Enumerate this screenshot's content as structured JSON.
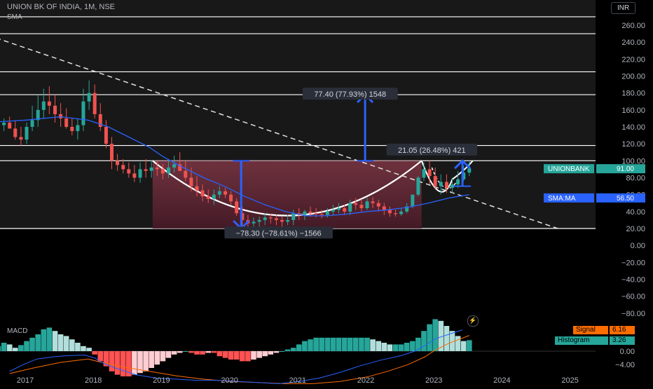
{
  "header": {
    "symbol_line": "UNION BK OF INDIA, 1M, NSE",
    "indicator_label": "SMA",
    "currency": "INR"
  },
  "colors": {
    "background": "#000000",
    "up_candle": "#26a69a",
    "down_candle": "#ef5350",
    "sma": "#2962ff",
    "macd_line": "#2962ff",
    "signal_line": "#ff6d00",
    "cup_fill": "#7a2a3c",
    "arrow": "#2962ff",
    "label_bg": "#2a2e39"
  },
  "chart_data": [
    {
      "type": "line",
      "panel": "price",
      "y_ticks": [
        "260.00",
        "240.00",
        "220.00",
        "200.00",
        "180.00",
        "160.00",
        "140.00",
        "120.00",
        "100.00",
        "80.00",
        "60.00",
        "40.00",
        "20.00",
        "0.00",
        "−20.00",
        "−40.00",
        "−60.00",
        "−80.00"
      ],
      "x_ticks": [
        "2017",
        "2018",
        "2019",
        "2020",
        "2021",
        "2022",
        "2023",
        "2024",
        "2025"
      ],
      "ylim": [
        -90,
        272
      ],
      "xlim": [
        2016.55,
        2025.6
      ],
      "horizontal_levels": [
        20,
        100,
        118,
        178,
        205,
        250,
        270
      ],
      "trendline": {
        "x": [
          2016.55,
          2024.8
        ],
        "y": [
          245,
          20
        ]
      },
      "series": [
        {
          "kind": "candles",
          "x": [
            2016.583,
            2016.667,
            2016.75,
            2016.833,
            2016.917,
            2017.0,
            2017.083,
            2017.167,
            2017.25,
            2017.333,
            2017.417,
            2017.5,
            2017.583,
            2017.667,
            2017.75,
            2017.833,
            2017.917,
            2018.0,
            2018.083,
            2018.167,
            2018.25,
            2018.333,
            2018.417,
            2018.5,
            2018.583,
            2018.667,
            2018.75,
            2018.833,
            2018.917,
            2019.0,
            2019.083,
            2019.167,
            2019.25,
            2019.333,
            2019.417,
            2019.5,
            2019.583,
            2019.667,
            2019.75,
            2019.833,
            2019.917,
            2020.0,
            2020.083,
            2020.167,
            2020.25,
            2020.333,
            2020.417,
            2020.5,
            2020.583,
            2020.667,
            2020.75,
            2020.833,
            2020.917,
            2021.0,
            2021.083,
            2021.167,
            2021.25,
            2021.333,
            2021.417,
            2021.5,
            2021.583,
            2021.667,
            2021.75,
            2021.833,
            2021.917,
            2022.0,
            2022.083,
            2022.167,
            2022.25,
            2022.333,
            2022.417,
            2022.5,
            2022.583,
            2022.667,
            2022.75,
            2022.833,
            2022.917,
            2023.0,
            2023.083,
            2023.167,
            2023.25,
            2023.333,
            2023.417,
            2023.5
          ],
          "open": [
            150,
            142,
            145,
            138,
            128,
            125,
            140,
            148,
            160,
            170,
            165,
            155,
            150,
            140,
            135,
            142,
            170,
            180,
            155,
            140,
            120,
            100,
            95,
            90,
            85,
            80,
            90,
            88,
            92,
            90,
            85,
            92,
            96,
            88,
            80,
            70,
            65,
            58,
            55,
            60,
            64,
            60,
            52,
            38,
            30,
            26,
            28,
            30,
            33,
            32,
            30,
            28,
            30,
            38,
            36,
            40,
            38,
            37,
            36,
            40,
            42,
            44,
            40,
            50,
            48,
            44,
            52,
            50,
            46,
            42,
            38,
            37,
            40,
            46,
            60,
            80,
            90,
            82,
            70,
            75,
            68,
            72,
            78,
            86
          ],
          "high": [
            160,
            150,
            152,
            148,
            140,
            145,
            165,
            178,
            185,
            188,
            178,
            168,
            162,
            150,
            150,
            185,
            195,
            190,
            168,
            148,
            128,
            108,
            102,
            98,
            95,
            98,
            102,
            100,
            100,
            96,
            102,
            106,
            110,
            100,
            92,
            82,
            72,
            66,
            66,
            70,
            68,
            64,
            56,
            46,
            36,
            33,
            34,
            38,
            37,
            36,
            34,
            36,
            42,
            44,
            42,
            46,
            44,
            42,
            44,
            48,
            50,
            48,
            54,
            56,
            55,
            56,
            57,
            54,
            50,
            46,
            42,
            44,
            50,
            60,
            82,
            98,
            100,
            92,
            84,
            84,
            80,
            88,
            94,
            100
          ],
          "low": [
            140,
            135,
            138,
            125,
            118,
            120,
            135,
            140,
            150,
            155,
            145,
            140,
            138,
            130,
            125,
            135,
            160,
            150,
            135,
            115,
            90,
            88,
            85,
            80,
            75,
            74,
            80,
            80,
            82,
            78,
            80,
            86,
            88,
            76,
            64,
            58,
            52,
            50,
            48,
            56,
            56,
            48,
            35,
            22,
            20,
            20,
            22,
            24,
            26,
            24,
            22,
            24,
            24,
            30,
            30,
            34,
            33,
            32,
            33,
            36,
            38,
            36,
            36,
            42,
            40,
            42,
            44,
            40,
            36,
            34,
            34,
            35,
            38,
            44,
            58,
            76,
            72,
            66,
            60,
            62,
            62,
            68,
            76,
            82
          ],
          "close": [
            142,
            145,
            138,
            128,
            125,
            140,
            148,
            160,
            170,
            165,
            155,
            150,
            140,
            135,
            142,
            170,
            180,
            155,
            140,
            120,
            100,
            95,
            90,
            85,
            80,
            90,
            88,
            92,
            90,
            85,
            92,
            96,
            88,
            80,
            70,
            65,
            58,
            55,
            60,
            64,
            60,
            52,
            38,
            30,
            26,
            28,
            30,
            33,
            32,
            30,
            28,
            30,
            38,
            36,
            40,
            38,
            37,
            36,
            40,
            42,
            44,
            40,
            50,
            48,
            44,
            52,
            50,
            46,
            42,
            38,
            37,
            40,
            46,
            60,
            80,
            90,
            82,
            70,
            75,
            68,
            72,
            78,
            86,
            91
          ]
        },
        {
          "name": "SMA",
          "kind": "line",
          "x": [
            2016.583,
            2017.0,
            2017.5,
            2017.9,
            2018.2,
            2018.5,
            2018.8,
            2019.0,
            2019.3,
            2019.6,
            2019.9,
            2020.2,
            2020.5,
            2020.8,
            2021.1,
            2021.4,
            2021.7,
            2022.0,
            2022.3,
            2022.6,
            2022.9,
            2023.2,
            2023.5
          ],
          "y": [
            146,
            148,
            152,
            148,
            140,
            128,
            116,
            105,
            92,
            80,
            70,
            58,
            48,
            40,
            35,
            35,
            37,
            40,
            42,
            45,
            50,
            56,
            60
          ]
        }
      ],
      "price_tags": [
        {
          "label": "UNIONBANK",
          "value": "91.00",
          "y": 91,
          "bg": "#26a69a"
        },
        {
          "label": "SMA:MA",
          "value": "56.50",
          "y": 56.5,
          "bg": "#2962ff"
        }
      ],
      "annotations": [
        {
          "text": "77.40 (77.93%) 1548",
          "anchor_x": 2021.75,
          "anchor_y": 178
        },
        {
          "text": "21.05 (26.48%) 421",
          "anchor_x": 2022.95,
          "anchor_y": 112
        },
        {
          "text": "−78.30 (−78.61%) −1566",
          "anchor_x": 2020.7,
          "anchor_y": 14
        }
      ],
      "arrows": [
        {
          "x": 2021.97,
          "from": 100,
          "to": 178
        },
        {
          "x": 2020.15,
          "from": 100,
          "to": 20
        },
        {
          "x": 2023.4,
          "from": 70,
          "to": 100
        }
      ],
      "cup_region": {
        "x_start": 2018.85,
        "x_end": 2022.8,
        "top": 100,
        "bottom": 20
      }
    },
    {
      "type": "bar",
      "panel": "macd",
      "title": "MACD",
      "y_ticks": [
        "0.00",
        "−4.00"
      ],
      "ylim": [
        -11,
        11
      ],
      "series": [
        {
          "name": "Histogram",
          "value_label": "3.26",
          "x": [
            2016.583,
            2016.667,
            2016.75,
            2016.833,
            2016.917,
            2017.0,
            2017.083,
            2017.167,
            2017.25,
            2017.333,
            2017.417,
            2017.5,
            2017.583,
            2017.667,
            2017.75,
            2017.833,
            2017.917,
            2018.0,
            2018.083,
            2018.167,
            2018.25,
            2018.333,
            2018.417,
            2018.5,
            2018.583,
            2018.667,
            2018.75,
            2018.833,
            2018.917,
            2019.0,
            2019.083,
            2019.167,
            2019.25,
            2019.333,
            2019.417,
            2019.5,
            2019.583,
            2019.667,
            2019.75,
            2019.833,
            2019.917,
            2020.0,
            2020.083,
            2020.167,
            2020.25,
            2020.333,
            2020.417,
            2020.5,
            2020.583,
            2020.667,
            2020.75,
            2020.833,
            2020.917,
            2021.0,
            2021.083,
            2021.167,
            2021.25,
            2021.333,
            2021.417,
            2021.5,
            2021.583,
            2021.667,
            2021.75,
            2021.833,
            2021.917,
            2022.0,
            2022.083,
            2022.167,
            2022.25,
            2022.333,
            2022.417,
            2022.5,
            2022.583,
            2022.667,
            2022.75,
            2022.833,
            2022.917,
            2023.0,
            2023.083,
            2023.167,
            2023.25,
            2023.333,
            2023.417,
            2023.5
          ],
          "values": [
            1.5,
            2.5,
            2.0,
            1.0,
            1.8,
            3.0,
            4.0,
            5.0,
            6.5,
            7.0,
            6.0,
            5.0,
            4.5,
            3.5,
            2.5,
            1.5,
            1.0,
            -1.0,
            -3.0,
            -4.5,
            -6.0,
            -7.0,
            -7.5,
            -7.5,
            -7.0,
            -6.5,
            -6.0,
            -5.0,
            -4.0,
            -3.0,
            -2.0,
            -1.0,
            -0.5,
            0.0,
            -0.5,
            -1.0,
            -1.0,
            -0.5,
            -0.5,
            -1.5,
            -2.0,
            -2.5,
            -2.5,
            -3.0,
            -3.0,
            -2.5,
            -2.0,
            -1.5,
            -1.0,
            -0.5,
            0.0,
            0.5,
            1.0,
            2.0,
            3.0,
            3.5,
            4.0,
            4.0,
            4.0,
            4.0,
            4.0,
            4.0,
            4.0,
            4.0,
            4.0,
            4.0,
            3.5,
            3.0,
            2.5,
            2.0,
            2.0,
            2.0,
            2.5,
            3.0,
            4.0,
            6.0,
            8.0,
            9.5,
            9.0,
            7.5,
            6.0,
            4.5,
            3.0,
            3.26
          ]
        },
        {
          "name": "MACD",
          "kind": "line",
          "x": [
            2016.75,
            2016.95,
            2017.15,
            2017.4,
            2017.6,
            2017.85,
            2018.0,
            2018.1,
            2018.3,
            2018.6,
            2018.9,
            2019.2,
            2019.5,
            2019.8,
            2020.1,
            2020.4,
            2020.7,
            2021.0,
            2021.3,
            2021.6,
            2021.9,
            2022.2,
            2022.5,
            2022.7,
            2022.85,
            2023.0,
            2023.2,
            2023.4
          ],
          "values": [
            -18,
            -12,
            -7,
            -5,
            -4,
            -3.5,
            -6,
            -10,
            -15,
            -21,
            -24,
            -25,
            -26,
            -26,
            -27,
            -28,
            -29,
            -27,
            -24,
            -19,
            -13,
            -8,
            -4,
            0,
            5,
            11,
            15,
            19
          ]
        },
        {
          "name": "Signal",
          "value_label": "6.16",
          "kind": "line",
          "x": [
            2016.75,
            2017.1,
            2017.5,
            2017.9,
            2018.1,
            2018.4,
            2018.8,
            2019.2,
            2019.6,
            2020.0,
            2020.4,
            2020.8,
            2021.2,
            2021.6,
            2022.0,
            2022.3,
            2022.6,
            2022.85,
            2023.0,
            2023.2,
            2023.5
          ],
          "values": [
            -20,
            -15,
            -10,
            -7,
            -10,
            -14,
            -18,
            -22,
            -25,
            -27,
            -28,
            -29,
            -29,
            -27,
            -23,
            -18,
            -12,
            -5,
            1,
            7,
            14
          ]
        }
      ]
    }
  ]
}
